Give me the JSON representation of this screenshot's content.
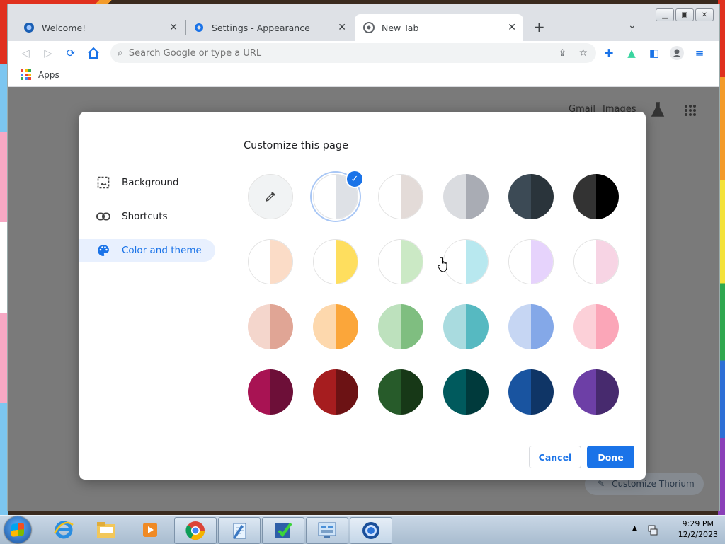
{
  "browser": {
    "tabs": [
      {
        "label": "Welcome!",
        "active": false
      },
      {
        "label": "Settings - Appearance",
        "active": false
      },
      {
        "label": "New Tab",
        "active": true
      }
    ],
    "omnibox_placeholder": "Search Google or type a URL",
    "bookmarks": {
      "apps_label": "Apps"
    }
  },
  "newtab": {
    "gmail": "Gmail",
    "images": "Images",
    "customize_button": "Customize Thorium"
  },
  "dialog": {
    "title": "Customize this page",
    "nav": [
      {
        "label": "Background",
        "icon": "image-icon",
        "active": false
      },
      {
        "label": "Shortcuts",
        "icon": "link-icon",
        "active": false
      },
      {
        "label": "Color and theme",
        "icon": "palette-icon",
        "active": true
      }
    ],
    "swatches": [
      {
        "name": "custom-color",
        "left": "#f1f3f4",
        "right": "#f1f3f4",
        "selected": false,
        "custom": true
      },
      {
        "name": "default",
        "left": "#ffffff",
        "right": "#dee1e6",
        "selected": true
      },
      {
        "name": "warm-grey",
        "left": "#ffffff",
        "right": "#e3dbd8",
        "selected": false
      },
      {
        "name": "cool-grey",
        "left": "#dadce0",
        "right": "#a9acb4",
        "selected": false
      },
      {
        "name": "midnight-blue",
        "left": "#3c4a55",
        "right": "#2a343b",
        "selected": false
      },
      {
        "name": "black",
        "left": "#333333",
        "right": "#000000",
        "selected": false
      },
      {
        "name": "beige-white",
        "left": "#ffffff",
        "right": "#fbdcc7",
        "selected": false
      },
      {
        "name": "yellow-white",
        "left": "#ffffff",
        "right": "#fede5e",
        "selected": false
      },
      {
        "name": "green-white",
        "left": "#ffffff",
        "right": "#cbe9c5",
        "selected": false
      },
      {
        "name": "light-teal-white",
        "left": "#ffffff",
        "right": "#b8e8ef",
        "selected": false
      },
      {
        "name": "light-purple-white",
        "left": "#ffffff",
        "right": "#e6d3fc",
        "selected": false
      },
      {
        "name": "pink-white",
        "left": "#ffffff",
        "right": "#f7d4e4",
        "selected": false
      },
      {
        "name": "peach",
        "left": "#f4d6cc",
        "right": "#e0a595",
        "selected": false
      },
      {
        "name": "orange",
        "left": "#fdd8ad",
        "right": "#fba63a",
        "selected": false
      },
      {
        "name": "light-green",
        "left": "#bde1bd",
        "right": "#7fbe80",
        "selected": false
      },
      {
        "name": "light-teal",
        "left": "#a9dbdf",
        "right": "#56b9c1",
        "selected": false
      },
      {
        "name": "light-blue",
        "left": "#c6d6f3",
        "right": "#84a8e8",
        "selected": false
      },
      {
        "name": "light-pink",
        "left": "#fcd0d8",
        "right": "#fba6b8",
        "selected": false
      },
      {
        "name": "dark-pink-red",
        "left": "#a81353",
        "right": "#6d0f38",
        "selected": false
      },
      {
        "name": "dark-red-orange",
        "left": "#a61d1f",
        "right": "#6c1214",
        "selected": false
      },
      {
        "name": "dark-green",
        "left": "#275b2a",
        "right": "#173817",
        "selected": false
      },
      {
        "name": "dark-teal",
        "left": "#005a5d",
        "right": "#003a3c",
        "selected": false
      },
      {
        "name": "dark-blue",
        "left": "#1954a0",
        "right": "#0f3566",
        "selected": false
      },
      {
        "name": "purple",
        "left": "#6d3fa6",
        "right": "#472a6e",
        "selected": false
      }
    ],
    "cancel_label": "Cancel",
    "done_label": "Done"
  },
  "taskbar": {
    "time": "9:29 PM",
    "date": "12/2/2023"
  },
  "colors": {
    "accent": "#1a73e8"
  }
}
